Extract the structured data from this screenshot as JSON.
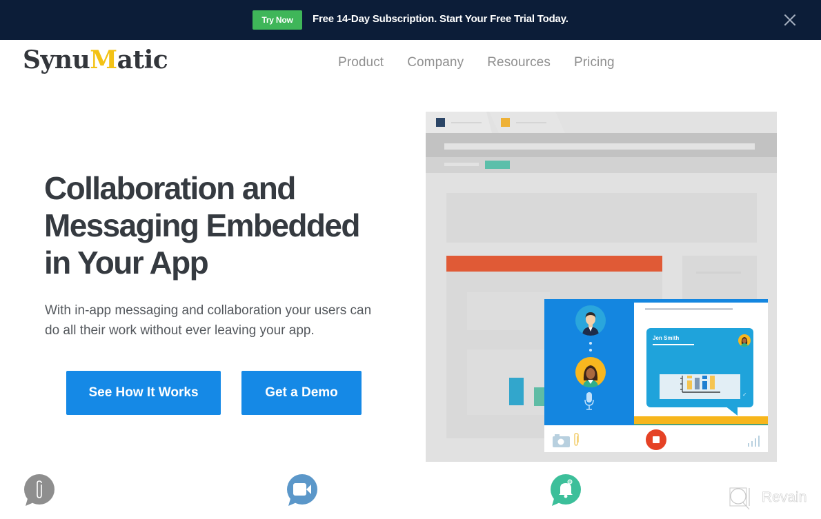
{
  "promo": {
    "button_label": "Try Now",
    "message": "Free 14-Day Subscription. Start Your Free Trial Today.",
    "close_icon": "close-icon",
    "background_color": "#0c1d38",
    "button_color": "#3fb659"
  },
  "header": {
    "logo": {
      "part1": "Synu",
      "part2": "M",
      "part3": "atic",
      "accent_color": "#f3c214"
    },
    "nav": [
      {
        "label": "Product"
      },
      {
        "label": "Company"
      },
      {
        "label": "Resources"
      },
      {
        "label": "Pricing"
      }
    ]
  },
  "hero": {
    "title_lines": [
      "Collaboration and",
      "Messaging Embedded",
      "in Your App"
    ],
    "subtitle_lines": [
      "With in-app messaging and collaboration your users can",
      "do all their work without ever leaving your app."
    ],
    "buttons": [
      {
        "label": "See How It Works"
      },
      {
        "label": "Get a Demo"
      }
    ],
    "button_color": "#1589e6"
  },
  "illustration": {
    "chat_bubble": {
      "sender": "Jen Smith",
      "status": "✓"
    },
    "icons": [
      "user-avatar-man",
      "user-avatar-woman",
      "microphone-icon",
      "camera-icon",
      "paperclip-icon",
      "stop-record-icon",
      "signal-icon"
    ]
  },
  "features": {
    "icons": [
      {
        "name": "attachment-chat-icon",
        "color": "#8e8e8e"
      },
      {
        "name": "video-chat-icon",
        "color": "#5b97c9"
      },
      {
        "name": "notification-chat-icon",
        "color": "#3cbf9a"
      }
    ]
  },
  "watermark": {
    "label": "Revain"
  }
}
